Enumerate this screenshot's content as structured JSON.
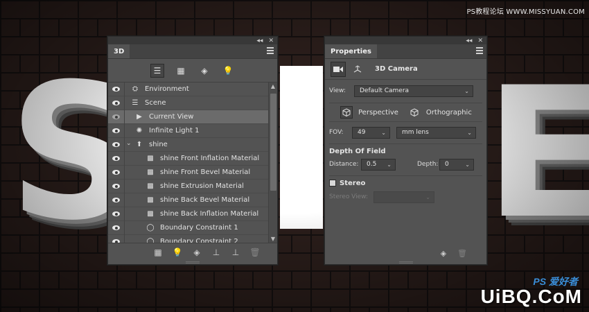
{
  "canvas": {
    "letters": {
      "left": "S",
      "right": "E"
    },
    "watermark_top": "PS教程论坛 WWW.MISSYUAN.COM",
    "watermark_ps": "PS 爱好者",
    "watermark_bottom": "UiBQ.CoM"
  },
  "panel_3d": {
    "tab": "3D",
    "topbar_collapse": "◂◂",
    "topbar_close": "✕",
    "filter_buttons": [
      {
        "name": "scene-filter-icon",
        "glyph": "☰",
        "active": true
      },
      {
        "name": "mesh-filter-icon",
        "glyph": "▦",
        "active": false
      },
      {
        "name": "material-filter-icon",
        "glyph": "◈",
        "active": false
      },
      {
        "name": "light-filter-icon",
        "glyph": "💡",
        "active": false
      }
    ],
    "rows": [
      {
        "label": "Environment",
        "icon": "⛭",
        "indent": 0,
        "eye": true
      },
      {
        "label": "Scene",
        "icon": "☰",
        "indent": 0,
        "eye": true
      },
      {
        "label": "Current View",
        "icon": "▶",
        "indent": 1,
        "eye": false,
        "selected": true
      },
      {
        "label": "Infinite Light 1",
        "icon": "✺",
        "indent": 1,
        "eye": true
      },
      {
        "label": "shine",
        "icon": "⬆",
        "indent": 1,
        "eye": true,
        "expanded": true
      },
      {
        "label": "shine Front Inflation Material",
        "icon": "▩",
        "indent": 2,
        "eye": true
      },
      {
        "label": "shine Front Bevel Material",
        "icon": "▩",
        "indent": 2,
        "eye": true
      },
      {
        "label": "shine Extrusion Material",
        "icon": "▩",
        "indent": 2,
        "eye": true
      },
      {
        "label": "shine Back Bevel Material",
        "icon": "▩",
        "indent": 2,
        "eye": true
      },
      {
        "label": "shine Back Inflation Material",
        "icon": "▩",
        "indent": 2,
        "eye": true
      },
      {
        "label": "Boundary Constraint 1",
        "icon": "◯",
        "indent": 2,
        "eye": true
      },
      {
        "label": "Boundary Constraint 2",
        "icon": "◯",
        "indent": 2,
        "eye": true
      }
    ],
    "bottom_buttons": [
      {
        "name": "render-icon",
        "glyph": "▦"
      },
      {
        "name": "add-light-icon",
        "glyph": "💡"
      },
      {
        "name": "new-mesh-icon",
        "glyph": "◈"
      },
      {
        "name": "drop-to-ground-icon",
        "glyph": "⊥"
      },
      {
        "name": "split-icon",
        "glyph": "⊥"
      },
      {
        "name": "trash-icon",
        "glyph": "🗑",
        "disabled": true
      }
    ]
  },
  "panel_props": {
    "tab": "Properties",
    "topbar_collapse": "◂◂",
    "topbar_close": "✕",
    "title": "3D Camera",
    "view_label": "View:",
    "view_value": "Default Camera",
    "perspective_label": "Perspective",
    "orthographic_label": "Orthographic",
    "fov_label": "FOV:",
    "fov_value": "49",
    "lens_value": "mm lens",
    "dof_title": "Depth Of Field",
    "distance_label": "Distance:",
    "distance_value": "0.5",
    "depth_label": "Depth:",
    "depth_value": "0",
    "stereo_label": "Stereo",
    "stereo_view_label": "Stereo View:",
    "stereo_view_value": ""
  },
  "colors": {
    "panel_bg": "#535353",
    "panel_dark": "#434343",
    "selected_row": "#6b6b6b",
    "text": "#dcdcdc"
  }
}
